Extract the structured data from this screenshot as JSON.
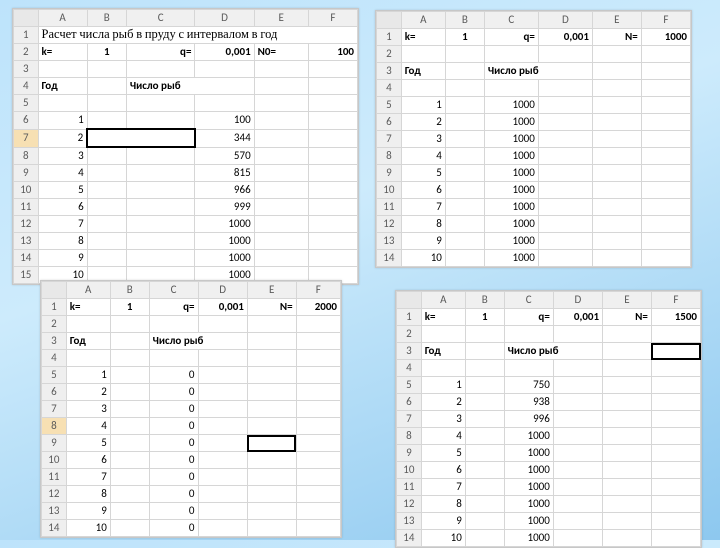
{
  "columns": [
    "A",
    "B",
    "C",
    "D",
    "E",
    "F"
  ],
  "header_year": "Год",
  "header_fish": "Число рыб",
  "param_k": "k=",
  "param_q": "q=",
  "param_n": "N=",
  "param_n0": "N0=",
  "sheet_tl": {
    "title": "Расчет числа рыб в пруду с интервалом в год",
    "k": "1",
    "q": "0,001",
    "n": "100",
    "years": [
      "1",
      "2",
      "3",
      "4",
      "5",
      "6",
      "7",
      "8",
      "9",
      "10"
    ],
    "fish": [
      "100",
      "344",
      "570",
      "815",
      "966",
      "999",
      "1000",
      "1000",
      "1000",
      "1000"
    ],
    "sel_row": 7
  },
  "sheet_tr": {
    "k": "1",
    "q": "0,001",
    "n": "1000",
    "years": [
      "1",
      "2",
      "3",
      "4",
      "5",
      "6",
      "7",
      "8",
      "9",
      "10"
    ],
    "fish": [
      "1000",
      "1000",
      "1000",
      "1000",
      "1000",
      "1000",
      "1000",
      "1000",
      "1000",
      "1000"
    ]
  },
  "sheet_bl": {
    "k": "1",
    "q": "0,001",
    "n": "2000",
    "years": [
      "1",
      "2",
      "3",
      "4",
      "5",
      "6",
      "7",
      "8",
      "9",
      "10"
    ],
    "fish": [
      "0",
      "0",
      "0",
      "0",
      "0",
      "0",
      "0",
      "0",
      "0",
      "0"
    ],
    "sel_rowh": 8,
    "sel_cell": "E9"
  },
  "sheet_br": {
    "k": "1",
    "q": "0,001",
    "n": "1500",
    "years": [
      "1",
      "2",
      "3",
      "4",
      "5",
      "6",
      "7",
      "8",
      "9",
      "10"
    ],
    "fish": [
      "750",
      "938",
      "996",
      "1000",
      "1000",
      "1000",
      "1000",
      "1000",
      "1000",
      "1000"
    ],
    "sel_cell": "F3"
  },
  "chart_data": [
    {
      "type": "table",
      "title": "N0=100",
      "x_name": "Год",
      "y_name": "Число рыб",
      "categories": [
        1,
        2,
        3,
        4,
        5,
        6,
        7,
        8,
        9,
        10
      ],
      "values": [
        100,
        344,
        570,
        815,
        966,
        999,
        1000,
        1000,
        1000,
        1000
      ],
      "k": 1,
      "q": 0.001
    },
    {
      "type": "table",
      "title": "N=1000",
      "x_name": "Год",
      "y_name": "Число рыб",
      "categories": [
        1,
        2,
        3,
        4,
        5,
        6,
        7,
        8,
        9,
        10
      ],
      "values": [
        1000,
        1000,
        1000,
        1000,
        1000,
        1000,
        1000,
        1000,
        1000,
        1000
      ],
      "k": 1,
      "q": 0.001
    },
    {
      "type": "table",
      "title": "N=2000",
      "x_name": "Год",
      "y_name": "Число рыб",
      "categories": [
        1,
        2,
        3,
        4,
        5,
        6,
        7,
        8,
        9,
        10
      ],
      "values": [
        0,
        0,
        0,
        0,
        0,
        0,
        0,
        0,
        0,
        0
      ],
      "k": 1,
      "q": 0.001
    },
    {
      "type": "table",
      "title": "N=1500",
      "x_name": "Год",
      "y_name": "Число рыб",
      "categories": [
        1,
        2,
        3,
        4,
        5,
        6,
        7,
        8,
        9,
        10
      ],
      "values": [
        750,
        938,
        996,
        1000,
        1000,
        1000,
        1000,
        1000,
        1000,
        1000
      ],
      "k": 1,
      "q": 0.001
    }
  ]
}
